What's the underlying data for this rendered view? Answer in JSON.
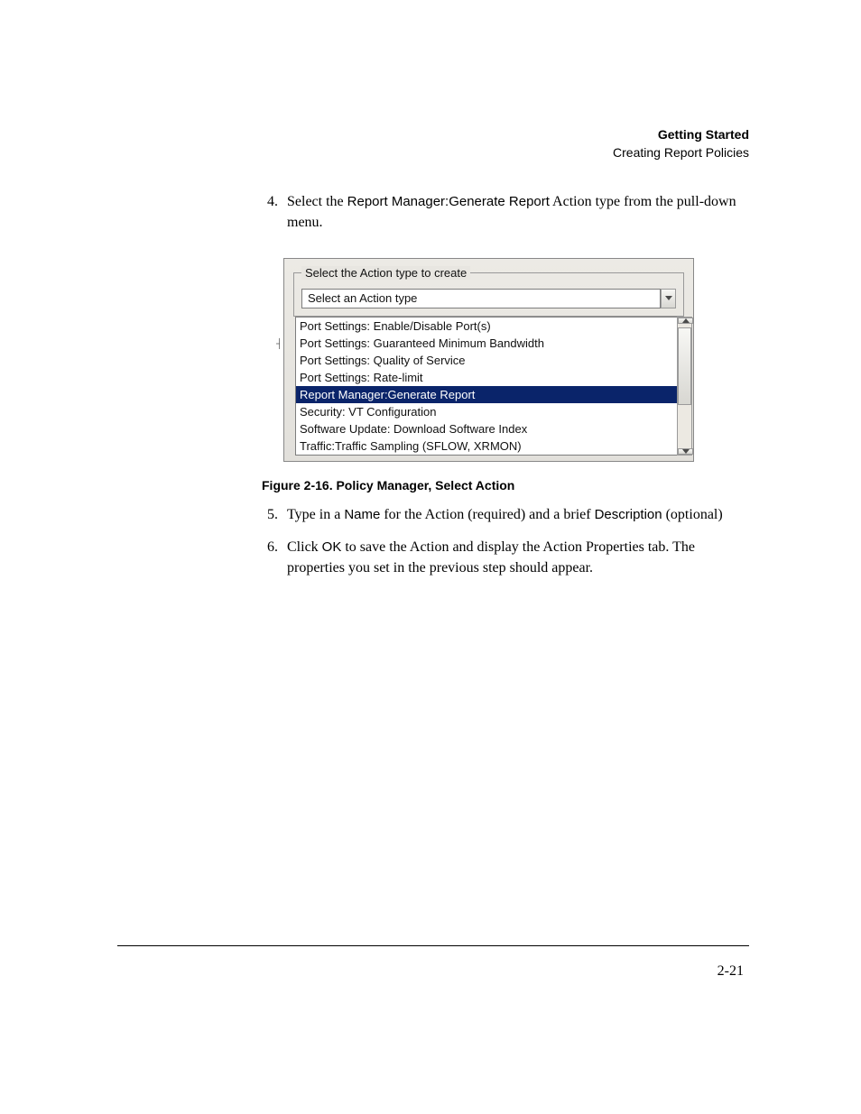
{
  "header": {
    "title": "Getting Started",
    "subtitle": "Creating Report Policies"
  },
  "steps": {
    "s4": {
      "num": "4.",
      "pre": "Select the ",
      "code": "Report Manager:Generate Report",
      "post": " Action type from the pull-down menu."
    },
    "s5": {
      "num": "5.",
      "pre": "Type in a ",
      "code1": "Name",
      "mid": " for the Action (required) and a brief ",
      "code2": "Description",
      "post": " (optional)"
    },
    "s6": {
      "num": "6.",
      "pre": "Click ",
      "code": "OK",
      "post": " to save the Action and display the Action Properties tab. The properties you set in the previous step should appear."
    }
  },
  "dialog": {
    "legend": "Select the Action type to create",
    "selected_text": "Select an Action type",
    "options": [
      "Port Settings: Enable/Disable Port(s)",
      "Port Settings: Guaranteed Minimum Bandwidth",
      "Port Settings: Quality of Service",
      "Port Settings: Rate-limit",
      "Report Manager:Generate Report",
      "Security: VT Configuration",
      "Software Update: Download Software Index",
      "Traffic:Traffic Sampling (SFLOW, XRMON)"
    ],
    "selected_index": 4
  },
  "caption": "Figure 2-16. Policy Manager, Select Action",
  "page_number": "2-21"
}
